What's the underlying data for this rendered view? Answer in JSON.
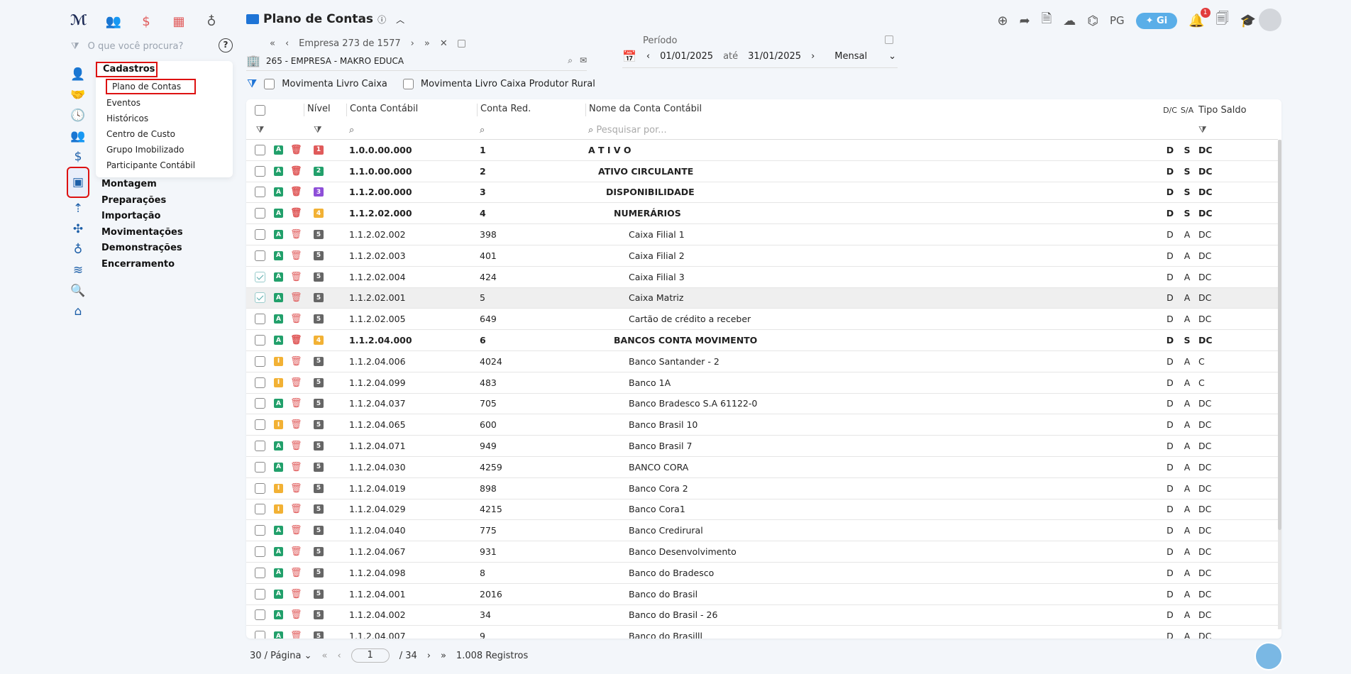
{
  "search": {
    "placeholder": "O que você procura?"
  },
  "menu": {
    "title": "Cadastros",
    "items": [
      "Plano de Contas",
      "Eventos",
      "Históricos",
      "Centro de Custo",
      "Grupo Imobilizado",
      "Participante Contábil"
    ],
    "sections": [
      "Montagem",
      "Preparações",
      "Importação",
      "Movimentações",
      "Demonstrações",
      "Encerramento"
    ]
  },
  "header": {
    "title": "Plano de Contas",
    "user_initials": "PG",
    "gi_label": "Gi",
    "notif_count": "1"
  },
  "company": {
    "nav_text": "Empresa 273 de 1577",
    "name": "265 - EMPRESA - MAKRO EDUCA"
  },
  "period": {
    "label": "Período",
    "from": "01/01/2025",
    "ate": "até",
    "to": "31/01/2025",
    "mode": "Mensal"
  },
  "filters": {
    "livro_caixa": "Movimenta Livro Caixa",
    "livro_rural": "Movimenta Livro Caixa Produtor Rural"
  },
  "table": {
    "headers": {
      "nivel": "Nível",
      "conta": "Conta Contábil",
      "red": "Conta Red.",
      "nome": "Nome da Conta Contábil",
      "dc": "D/C",
      "sa": "S/A",
      "tipo": "Tipo Saldo"
    },
    "search_placeholder": "Pesquisar por...",
    "rows": [
      {
        "status": "A",
        "level": "1",
        "conta": "1.0.0.00.000",
        "red": "1",
        "nome": "A T I V O",
        "dc": "D",
        "sa": "S",
        "tipo": "DC",
        "bold": true,
        "indent": 0
      },
      {
        "status": "A",
        "level": "2",
        "conta": "1.1.0.00.000",
        "red": "2",
        "nome": "ATIVO CIRCULANTE",
        "dc": "D",
        "sa": "S",
        "tipo": "DC",
        "bold": true,
        "indent": 1
      },
      {
        "status": "A",
        "level": "3",
        "conta": "1.1.2.00.000",
        "red": "3",
        "nome": "DISPONIBILIDADE",
        "dc": "D",
        "sa": "S",
        "tipo": "DC",
        "bold": true,
        "indent": 2
      },
      {
        "status": "A",
        "level": "4",
        "conta": "1.1.2.02.000",
        "red": "4",
        "nome": "NUMERÁRIOS",
        "dc": "D",
        "sa": "S",
        "tipo": "DC",
        "bold": true,
        "indent": 3
      },
      {
        "status": "A",
        "level": "5",
        "conta": "1.1.2.02.002",
        "red": "398",
        "nome": "Caixa Filial 1",
        "dc": "D",
        "sa": "A",
        "tipo": "DC",
        "indent": 4
      },
      {
        "status": "A",
        "level": "5",
        "conta": "1.1.2.02.003",
        "red": "401",
        "nome": "Caixa Filial 2",
        "dc": "D",
        "sa": "A",
        "tipo": "DC",
        "indent": 4
      },
      {
        "status": "A",
        "level": "5",
        "conta": "1.1.2.02.004",
        "red": "424",
        "nome": "Caixa Filial 3",
        "dc": "D",
        "sa": "A",
        "tipo": "DC",
        "indent": 4,
        "checked": true
      },
      {
        "status": "A",
        "level": "5",
        "conta": "1.1.2.02.001",
        "red": "5",
        "nome": "Caixa Matriz",
        "dc": "D",
        "sa": "A",
        "tipo": "DC",
        "indent": 4,
        "checked": true,
        "hl": true
      },
      {
        "status": "A",
        "level": "5",
        "conta": "1.1.2.02.005",
        "red": "649",
        "nome": "Cartão de crédito a receber",
        "dc": "D",
        "sa": "A",
        "tipo": "DC",
        "indent": 4
      },
      {
        "status": "A",
        "level": "4",
        "conta": "1.1.2.04.000",
        "red": "6",
        "nome": "BANCOS CONTA MOVIMENTO",
        "dc": "D",
        "sa": "S",
        "tipo": "DC",
        "bold": true,
        "indent": 3
      },
      {
        "status": "I",
        "level": "5",
        "conta": "1.1.2.04.006",
        "red": "4024",
        "nome": "Banco Santander - 2",
        "dc": "D",
        "sa": "A",
        "tipo": "C",
        "indent": 4
      },
      {
        "status": "I",
        "level": "5",
        "conta": "1.1.2.04.099",
        "red": "483",
        "nome": "Banco 1A",
        "dc": "D",
        "sa": "A",
        "tipo": "C",
        "indent": 4
      },
      {
        "status": "A",
        "level": "5",
        "conta": "1.1.2.04.037",
        "red": "705",
        "nome": "Banco Bradesco S.A 61122-0",
        "dc": "D",
        "sa": "A",
        "tipo": "DC",
        "indent": 4
      },
      {
        "status": "I",
        "level": "5",
        "conta": "1.1.2.04.065",
        "red": "600",
        "nome": "Banco Brasil 10",
        "dc": "D",
        "sa": "A",
        "tipo": "DC",
        "indent": 4
      },
      {
        "status": "A",
        "level": "5",
        "conta": "1.1.2.04.071",
        "red": "949",
        "nome": "Banco Brasil 7",
        "dc": "D",
        "sa": "A",
        "tipo": "DC",
        "indent": 4
      },
      {
        "status": "A",
        "level": "5",
        "conta": "1.1.2.04.030",
        "red": "4259",
        "nome": "BANCO CORA",
        "dc": "D",
        "sa": "A",
        "tipo": "DC",
        "indent": 4
      },
      {
        "status": "I",
        "level": "5",
        "conta": "1.1.2.04.019",
        "red": "898",
        "nome": "Banco Cora 2",
        "dc": "D",
        "sa": "A",
        "tipo": "DC",
        "indent": 4
      },
      {
        "status": "I",
        "level": "5",
        "conta": "1.1.2.04.029",
        "red": "4215",
        "nome": "Banco Cora1",
        "dc": "D",
        "sa": "A",
        "tipo": "DC",
        "indent": 4
      },
      {
        "status": "A",
        "level": "5",
        "conta": "1.1.2.04.040",
        "red": "775",
        "nome": "Banco Credirural",
        "dc": "D",
        "sa": "A",
        "tipo": "DC",
        "indent": 4
      },
      {
        "status": "A",
        "level": "5",
        "conta": "1.1.2.04.067",
        "red": "931",
        "nome": "Banco Desenvolvimento",
        "dc": "D",
        "sa": "A",
        "tipo": "DC",
        "indent": 4
      },
      {
        "status": "A",
        "level": "5",
        "conta": "1.1.2.04.098",
        "red": "8",
        "nome": "Banco do Bradesco",
        "dc": "D",
        "sa": "A",
        "tipo": "DC",
        "indent": 4
      },
      {
        "status": "A",
        "level": "5",
        "conta": "1.1.2.04.001",
        "red": "2016",
        "nome": "Banco do Brasil",
        "dc": "D",
        "sa": "A",
        "tipo": "DC",
        "indent": 4
      },
      {
        "status": "A",
        "level": "5",
        "conta": "1.1.2.04.002",
        "red": "34",
        "nome": "Banco do Brasil - 26",
        "dc": "D",
        "sa": "A",
        "tipo": "DC",
        "indent": 4
      },
      {
        "status": "A",
        "level": "5",
        "conta": "1.1.2.04.007",
        "red": "9",
        "nome": "Banco do Brasilll",
        "dc": "D",
        "sa": "A",
        "tipo": "DC",
        "indent": 4
      }
    ]
  },
  "pager": {
    "per_page": "30 / Página",
    "page": "1",
    "total_pages": "/ 34",
    "records": "1.008 Registros"
  }
}
